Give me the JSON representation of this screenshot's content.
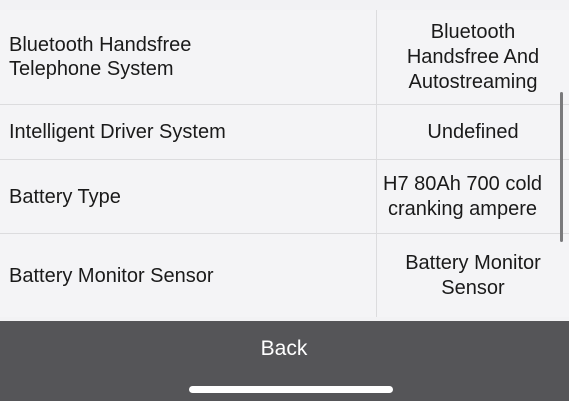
{
  "specs": {
    "rows": [
      {
        "label": "Bluetooth Handsfree\nTelephone System",
        "value": "Bluetooth\nHandsfree And\nAutostreaming"
      },
      {
        "label": "Intelligent Driver System",
        "value": "Undefined"
      },
      {
        "label": "Battery Type",
        "value": "H7 80Ah 700 cold\ncranking ampere"
      },
      {
        "label": "Battery Monitor Sensor",
        "value": "Battery Monitor\nSensor"
      }
    ]
  },
  "footer": {
    "back_label": "Back"
  },
  "colors": {
    "background": "#f4f4f6",
    "footer": "#555558",
    "text": "#1a1a1a"
  }
}
